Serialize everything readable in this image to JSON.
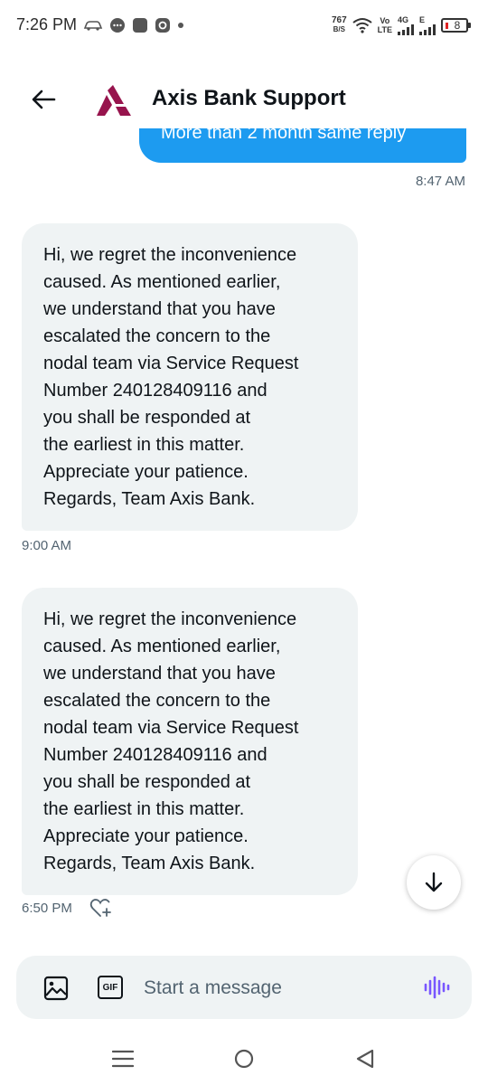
{
  "status_bar": {
    "time": "7:26 PM",
    "net_speed_value": "767",
    "net_speed_unit": "B/S",
    "volte_top": "Vo",
    "volte_bottom": "LTE",
    "network_4g": "4G",
    "network_e": "E",
    "battery": "8"
  },
  "header": {
    "title": "Axis Bank Support",
    "brand_color": "#97144d"
  },
  "messages": [
    {
      "direction": "sent",
      "text": "More than 2 month same reply",
      "time": "8:47 AM"
    },
    {
      "direction": "received",
      "lines": [
        "Hi, we regret the inconvenience",
        "caused. As mentioned earlier,",
        "we understand that you have",
        "escalated the concern to the",
        "nodal team via Service Request",
        "Number 240128409116 and",
        "you shall be responded at",
        "the earliest in this matter.",
        "Appreciate your patience.",
        "Regards, Team Axis Bank."
      ],
      "time": "9:00 AM"
    },
    {
      "direction": "received",
      "lines": [
        "Hi, we regret the inconvenience",
        "caused. As mentioned earlier,",
        "we understand that you have",
        "escalated the concern to the",
        "nodal team via Service Request",
        "Number 240128409116 and",
        "you shall be responded at",
        "the earliest in this matter.",
        "Appreciate your patience.",
        "Regards, Team Axis Bank."
      ],
      "time": "6:50 PM"
    }
  ],
  "composer": {
    "placeholder": "Start a message",
    "gif_label": "GIF",
    "accent_color": "#7856ff"
  },
  "colors": {
    "sent_bubble": "#1d9bf0",
    "received_bubble": "#eff3f4",
    "secondary_text": "#536471"
  }
}
